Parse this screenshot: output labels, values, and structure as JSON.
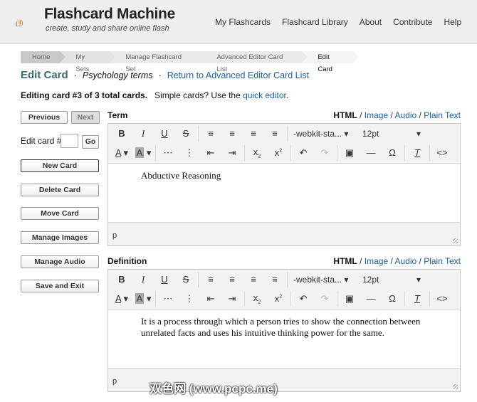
{
  "header": {
    "logo_title": "Flashcard Machine",
    "logo_tagline": "create, study and share online flash",
    "nav": [
      "My Flashcards",
      "Flashcard Library",
      "About",
      "Contribute",
      "Help"
    ]
  },
  "breadcrumb": [
    "Home",
    "My Sets",
    "Manage Flashcard Set",
    "Advanced Editor Card List",
    "Edit Card"
  ],
  "title": {
    "heading": "Edit Card",
    "set_name": "Psychology terms",
    "return_link": "Return to Advanced Editor Card List",
    "sep": "·"
  },
  "info": {
    "editing": "Editing card #3 of 3 total cards.",
    "simple": "Simple cards? Use the",
    "quick": "quick editor",
    "period": "."
  },
  "sidebar": {
    "previous": "Previous",
    "next": "Next",
    "edit_card_label": "Edit card #",
    "edit_card_value": "",
    "go": "Go",
    "buttons": [
      "New Card",
      "Delete Card",
      "Move Card",
      "Manage Images",
      "Manage Audio",
      "Save and Exit"
    ]
  },
  "modes": {
    "html": "HTML",
    "image": "Image",
    "audio": "Audio",
    "plain": "Plain Text",
    "slash": " / "
  },
  "toolbar": {
    "font": "-webkit-sta...",
    "size": "12pt"
  },
  "term": {
    "label": "Term",
    "content": "Abductive Reasoning",
    "status": "p"
  },
  "definition": {
    "label": "Definition",
    "content": "It is a process through which a person tries to show the connection between unrelated facts and uses his intuitive thinking power for the same.",
    "status": "p"
  },
  "watermark": "双色网 (www.pcpc.me)"
}
